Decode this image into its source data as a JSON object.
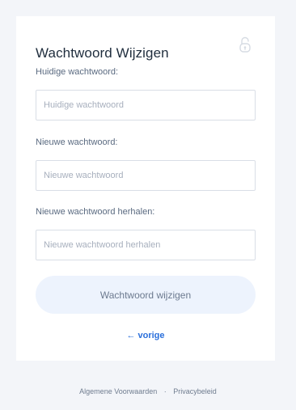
{
  "form": {
    "title": "Wachtwoord Wijzigen",
    "lock_icon": "unlock-icon",
    "fields": [
      {
        "label": "Huidige wachtwoord:",
        "placeholder": "Huidige wachtwoord",
        "value": ""
      },
      {
        "label": "Nieuwe wachtwoord:",
        "placeholder": "Nieuwe wachtwoord",
        "value": ""
      },
      {
        "label": "Nieuwe wachtwoord herhalen:",
        "placeholder": "Nieuwe wachtwoord herhalen",
        "value": ""
      }
    ],
    "submit_label": "Wachtwoord wijzigen",
    "back_label": "← vorige"
  },
  "footer": {
    "terms_label": "Algemene Voorwaarden",
    "separator": "·",
    "privacy_label": "Privacybeleid"
  },
  "colors": {
    "page_background": "#f3f5f9",
    "card_background": "#ffffff",
    "button_background": "#edf3fd",
    "link": "#2a6fdb"
  }
}
